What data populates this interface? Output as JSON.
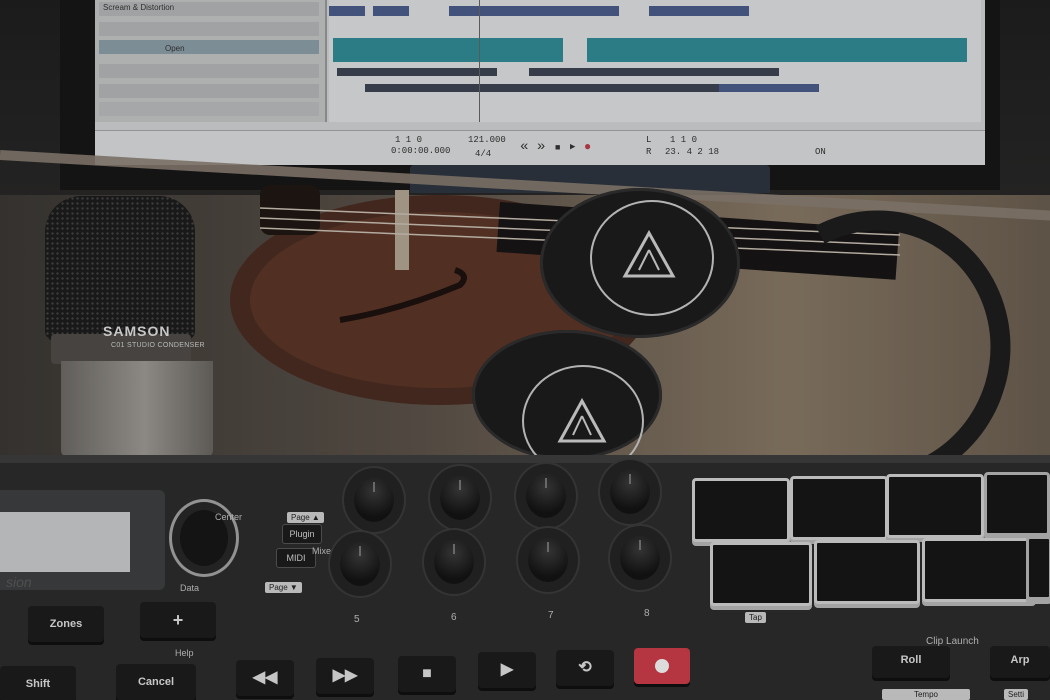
{
  "daw": {
    "track1": "Scream & Distortion",
    "open": "Open",
    "position1": "1 1 0",
    "position2": "0:00:00.000",
    "tempo": "121.000",
    "meter": "4/4",
    "loop_l": "L",
    "loop_r": "R",
    "loop_l_val": "1 1 0",
    "loop_r_val": "23. 4 2 18",
    "on": "ON"
  },
  "mic": {
    "brand": "SAMSON",
    "model": "C01 STUDIO CONDENSER"
  },
  "controller": {
    "center": "Center",
    "data": "Data",
    "page_up": "Page ▲",
    "page_down": "Page ▼",
    "plugin": "Plugin",
    "midi": "MIDI",
    "mixer": "Mixer",
    "knob_numbers": [
      "5",
      "6",
      "7",
      "8"
    ],
    "zones": "Zones",
    "plus": "+",
    "shift": "Shift",
    "cancel": "Cancel",
    "help": "Help",
    "tap": "Tap",
    "clip_launch": "Clip Launch",
    "roll": "Roll",
    "arp": "Arp",
    "tempo": "Tempo",
    "setup": "Setti",
    "brand_fragment": "sion"
  },
  "colors": {
    "record": "#d23b48",
    "clip_teal": "#2f8f98",
    "clip_blue": "#4a5d8c"
  }
}
